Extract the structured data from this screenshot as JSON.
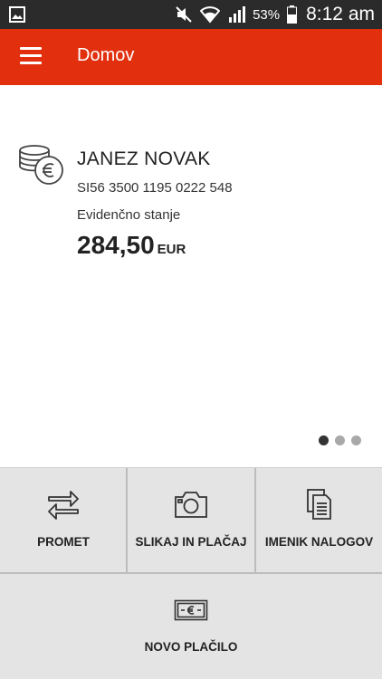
{
  "status_bar": {
    "battery_percent": "53%",
    "time": "8:12 am",
    "icons": [
      "gallery-notification-icon",
      "mute-icon",
      "wifi-icon",
      "signal-icon",
      "battery-icon"
    ]
  },
  "app_bar": {
    "title": "Domov",
    "menu_icon": "hamburger-menu-icon"
  },
  "account": {
    "icon": "coins-euro-icon",
    "holder_name": "JANEZ NOVAK",
    "iban": "SI56 3500 1195 0222 548",
    "balance_label": "Evidenčno stanje",
    "balance_amount": "284,50",
    "currency": "EUR"
  },
  "pager": {
    "pages": 3,
    "active_index": 0
  },
  "actions": [
    {
      "label": "PROMET",
      "icon": "transfer-arrows-icon"
    },
    {
      "label": "SLIKAJ IN PLAČAJ",
      "icon": "camera-icon"
    },
    {
      "label": "IMENIK NALOGOV",
      "icon": "documents-icon"
    },
    {
      "label": "NOVO PLAČILO",
      "icon": "euro-banknote-icon"
    }
  ],
  "colors": {
    "app_bar": "#e2300f",
    "status_bar": "#2b2b2b",
    "tiles": "#e4e4e4"
  }
}
